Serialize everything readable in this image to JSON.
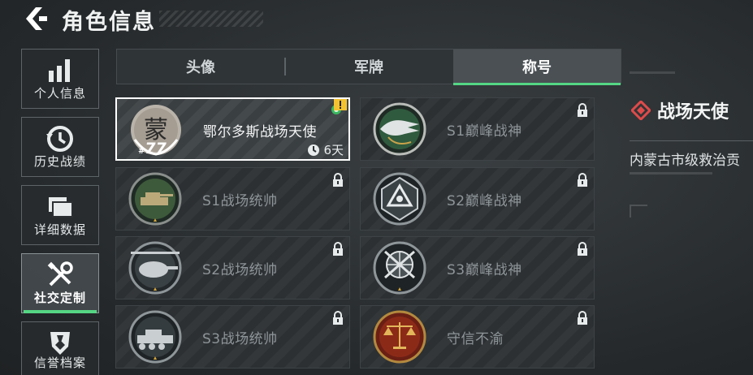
{
  "header": {
    "title": "角色信息"
  },
  "sidebar": {
    "items": [
      {
        "label": "个人信息",
        "icon": "bar-chart-icon",
        "active": false
      },
      {
        "label": "历史战绩",
        "icon": "history-clock-icon",
        "active": false
      },
      {
        "label": "详细数据",
        "icon": "folder-icon",
        "active": false
      },
      {
        "label": "社交定制",
        "icon": "tools-icon",
        "active": true
      },
      {
        "label": "信誉档案",
        "icon": "credit-badge-icon",
        "active": false
      }
    ]
  },
  "tabs": [
    {
      "label": "头像",
      "active": false
    },
    {
      "label": "军牌",
      "active": false
    },
    {
      "label": "称号",
      "active": true
    }
  ],
  "titles": [
    {
      "name": "鄂尔多斯战场天使",
      "emblem": "city-emblem-icon",
      "emblem_char": "蒙",
      "number": "77",
      "timer": "6天",
      "locked": false,
      "selected": true
    },
    {
      "name": "S1巅峰战神",
      "emblem": "crocodile-emblem-icon",
      "locked": true,
      "selected": false
    },
    {
      "name": "S1战场统帅",
      "emblem": "tank-emblem-icon",
      "locked": true,
      "selected": false
    },
    {
      "name": "S2巅峰战神",
      "emblem": "triangle-emblem-icon",
      "locked": true,
      "selected": false
    },
    {
      "name": "S2战场统帅",
      "emblem": "helicopter-emblem-icon",
      "locked": true,
      "selected": false
    },
    {
      "name": "S3巅峰战神",
      "emblem": "globe-emblem-icon",
      "locked": true,
      "selected": false
    },
    {
      "name": "S3战场统帅",
      "emblem": "armored-vehicle-emblem-icon",
      "locked": true,
      "selected": false
    },
    {
      "name": "守信不渝",
      "emblem": "scales-emblem-icon",
      "locked": true,
      "selected": false
    }
  ],
  "detail": {
    "name": "战场天使",
    "description": "内蒙古市级救治贡"
  },
  "colors": {
    "accent": "#55d684",
    "diamond": "#e04a4a",
    "warning": "#f2c230"
  }
}
